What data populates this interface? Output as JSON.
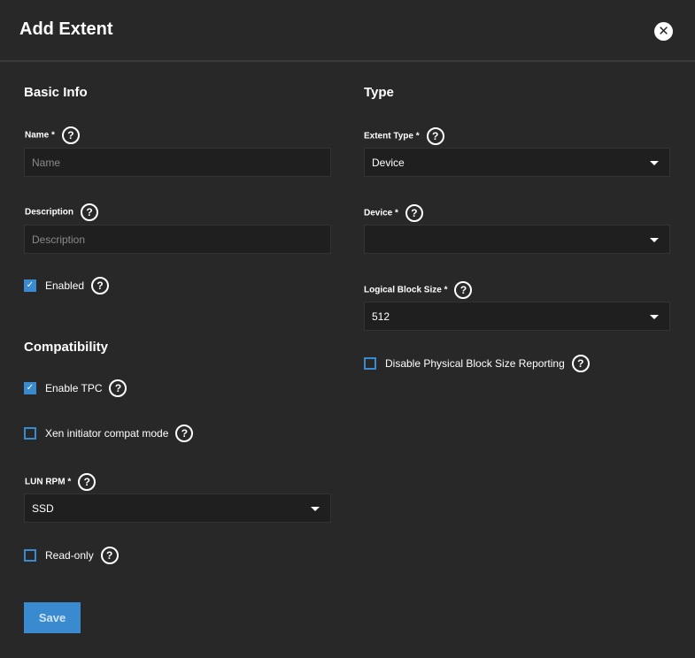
{
  "dialog": {
    "title": "Add Extent",
    "close_label": "✕"
  },
  "basic_info": {
    "heading": "Basic Info",
    "name": {
      "label": "Name *",
      "placeholder": "Name",
      "value": ""
    },
    "description": {
      "label": "Description",
      "placeholder": "Description",
      "value": ""
    },
    "enabled": {
      "label": "Enabled",
      "checked": true
    }
  },
  "compatibility": {
    "heading": "Compatibility",
    "enable_tpc": {
      "label": "Enable TPC",
      "checked": true
    },
    "xen_compat": {
      "label": "Xen initiator compat mode",
      "checked": false
    },
    "lun_rpm": {
      "label": "LUN RPM *",
      "value": "SSD"
    },
    "read_only": {
      "label": "Read-only",
      "checked": false
    }
  },
  "type": {
    "heading": "Type",
    "extent_type": {
      "label": "Extent Type *",
      "value": "Device"
    },
    "device": {
      "label": "Device *",
      "value": ""
    },
    "logical_block_size": {
      "label": "Logical Block Size *",
      "value": "512"
    },
    "disable_pbs": {
      "label": "Disable Physical Block Size Reporting",
      "checked": false
    }
  },
  "help_glyph": "?",
  "footer": {
    "save_label": "Save"
  },
  "colors": {
    "background": "#282828",
    "input_bg": "#1f1f1f",
    "accent": "#3a8ad0"
  },
  "icons": {
    "help": "help-circle-icon",
    "close": "close-icon",
    "dropdown": "caret-down-icon",
    "checkbox": "check-icon"
  }
}
